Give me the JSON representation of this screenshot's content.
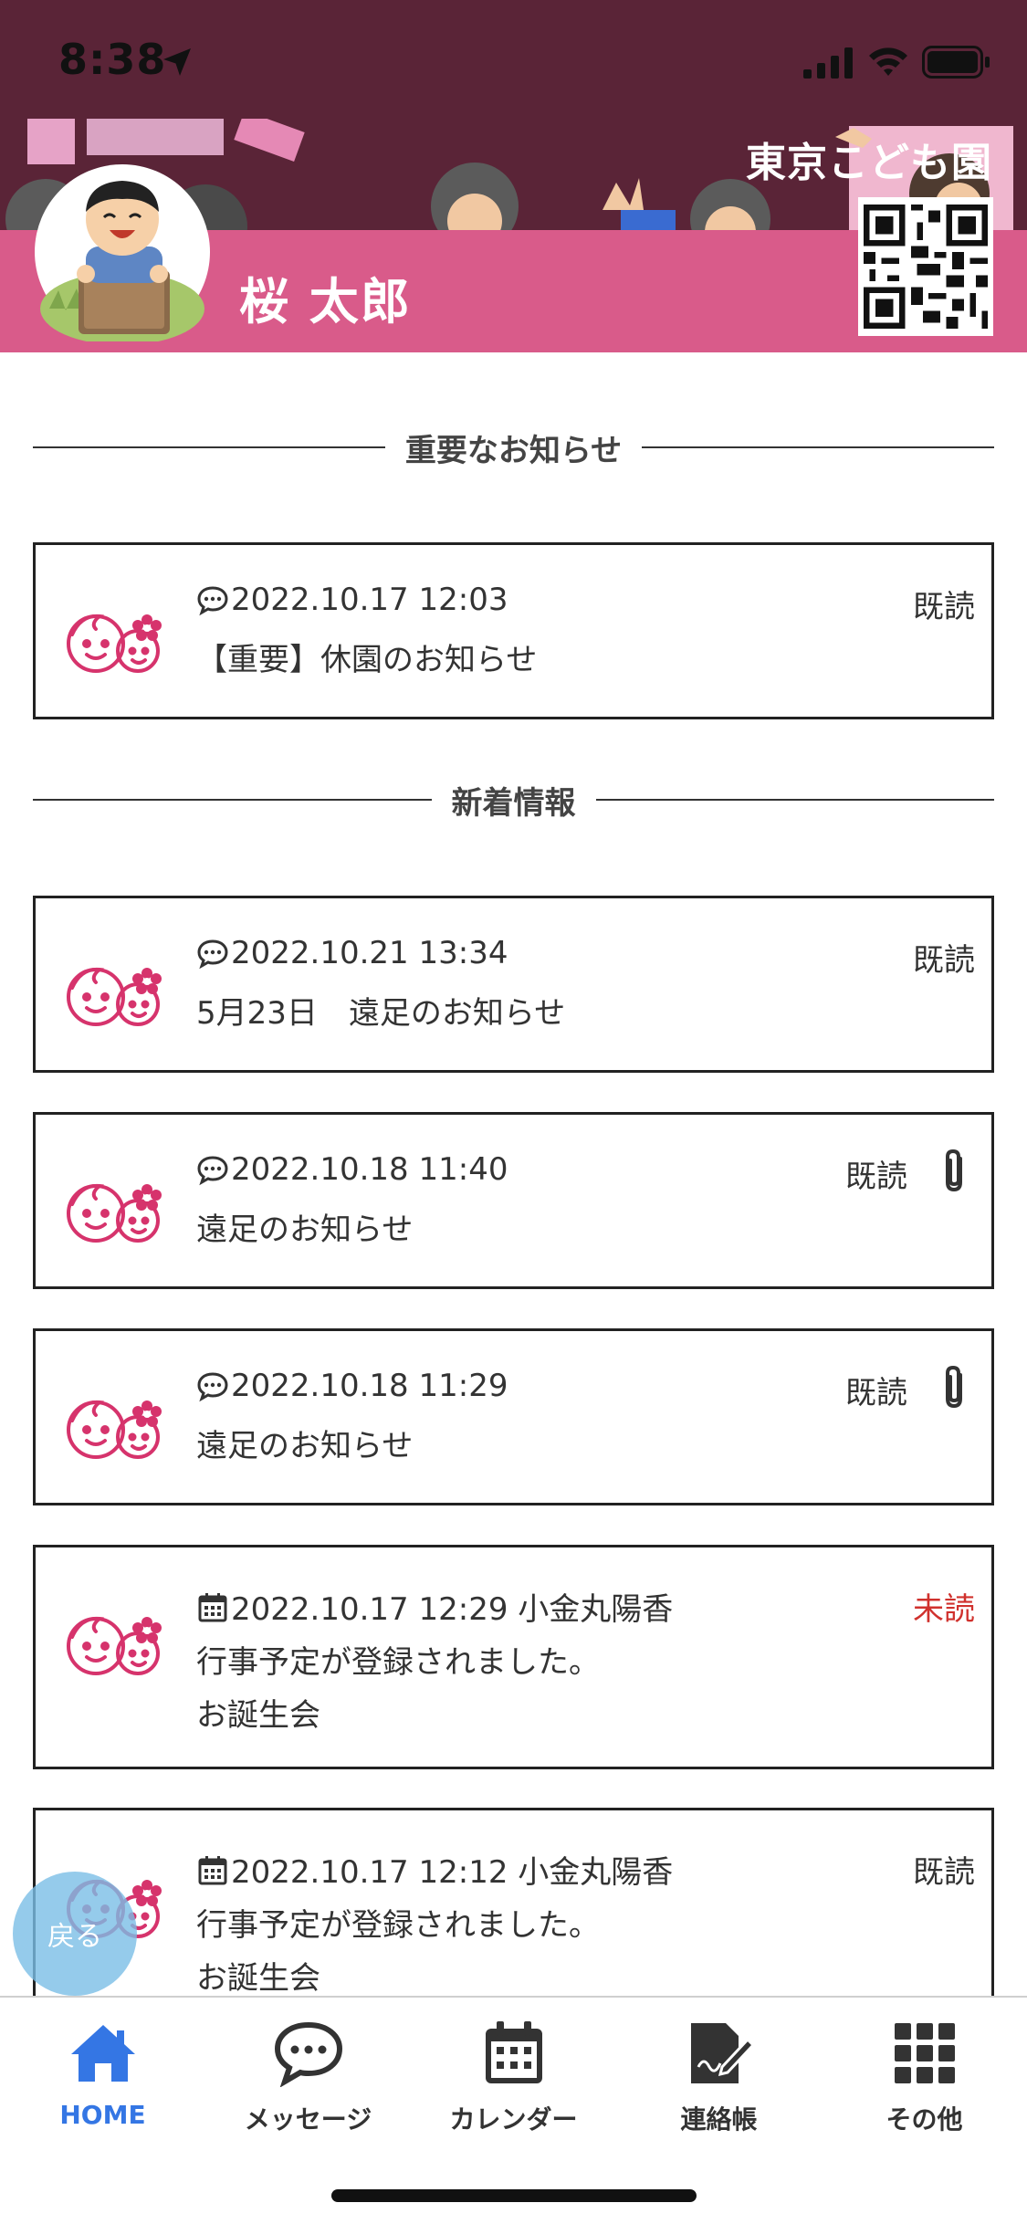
{
  "status_bar": {
    "time": "8:38"
  },
  "header": {
    "school_name": "東京こども園",
    "child_name": "桜 太郎"
  },
  "sections": {
    "important": "重要なお知らせ",
    "latest": "新着情報"
  },
  "important_notices": [
    {
      "icon": "message-icon",
      "datetime": "2022.10.17 12:03",
      "lines": [
        "【重要】休園のお知らせ"
      ],
      "status": "既読",
      "status_color": "#333333",
      "attachment": false
    }
  ],
  "latest_notices": [
    {
      "icon": "message-icon",
      "datetime": "2022.10.21 13:34",
      "lines": [
        "5月23日　遠足のお知らせ"
      ],
      "status": "既読",
      "status_color": "#333333",
      "attachment": false
    },
    {
      "icon": "message-icon",
      "datetime": "2022.10.18 11:40",
      "lines": [
        "遠足のお知らせ"
      ],
      "status": "既読",
      "status_color": "#333333",
      "attachment": true
    },
    {
      "icon": "message-icon",
      "datetime": "2022.10.18 11:29",
      "lines": [
        "遠足のお知らせ"
      ],
      "status": "既読",
      "status_color": "#333333",
      "attachment": true
    },
    {
      "icon": "calendar-icon",
      "datetime": "2022.10.17 12:29 小金丸陽香",
      "lines": [
        "行事予定が登録されました。",
        "お誕生会"
      ],
      "status": "未読",
      "status_color": "#d0312d",
      "attachment": false
    },
    {
      "icon": "calendar-icon",
      "datetime": "2022.10.17 12:12 小金丸陽香",
      "lines": [
        "行事予定が登録されました。",
        "お誕生会"
      ],
      "status": "既読",
      "status_color": "#333333",
      "attachment": false
    }
  ],
  "back_button": {
    "label": "戻る"
  },
  "tabbar": {
    "active_color": "#3476e4",
    "items": [
      {
        "label": "HOME",
        "icon": "home-icon",
        "active": true
      },
      {
        "label": "メッセージ",
        "icon": "speech-bubble-icon",
        "active": false
      },
      {
        "label": "カレンダー",
        "icon": "calendar-icon",
        "active": false
      },
      {
        "label": "連絡帳",
        "icon": "notebook-pen-icon",
        "active": false
      },
      {
        "label": "その他",
        "icon": "grid-icon",
        "active": false
      }
    ]
  },
  "colors": {
    "header_bg": "#5a2437",
    "header_band": "#d95b8a",
    "logo_pink": "#d6336c",
    "unread_red": "#d0312d"
  }
}
